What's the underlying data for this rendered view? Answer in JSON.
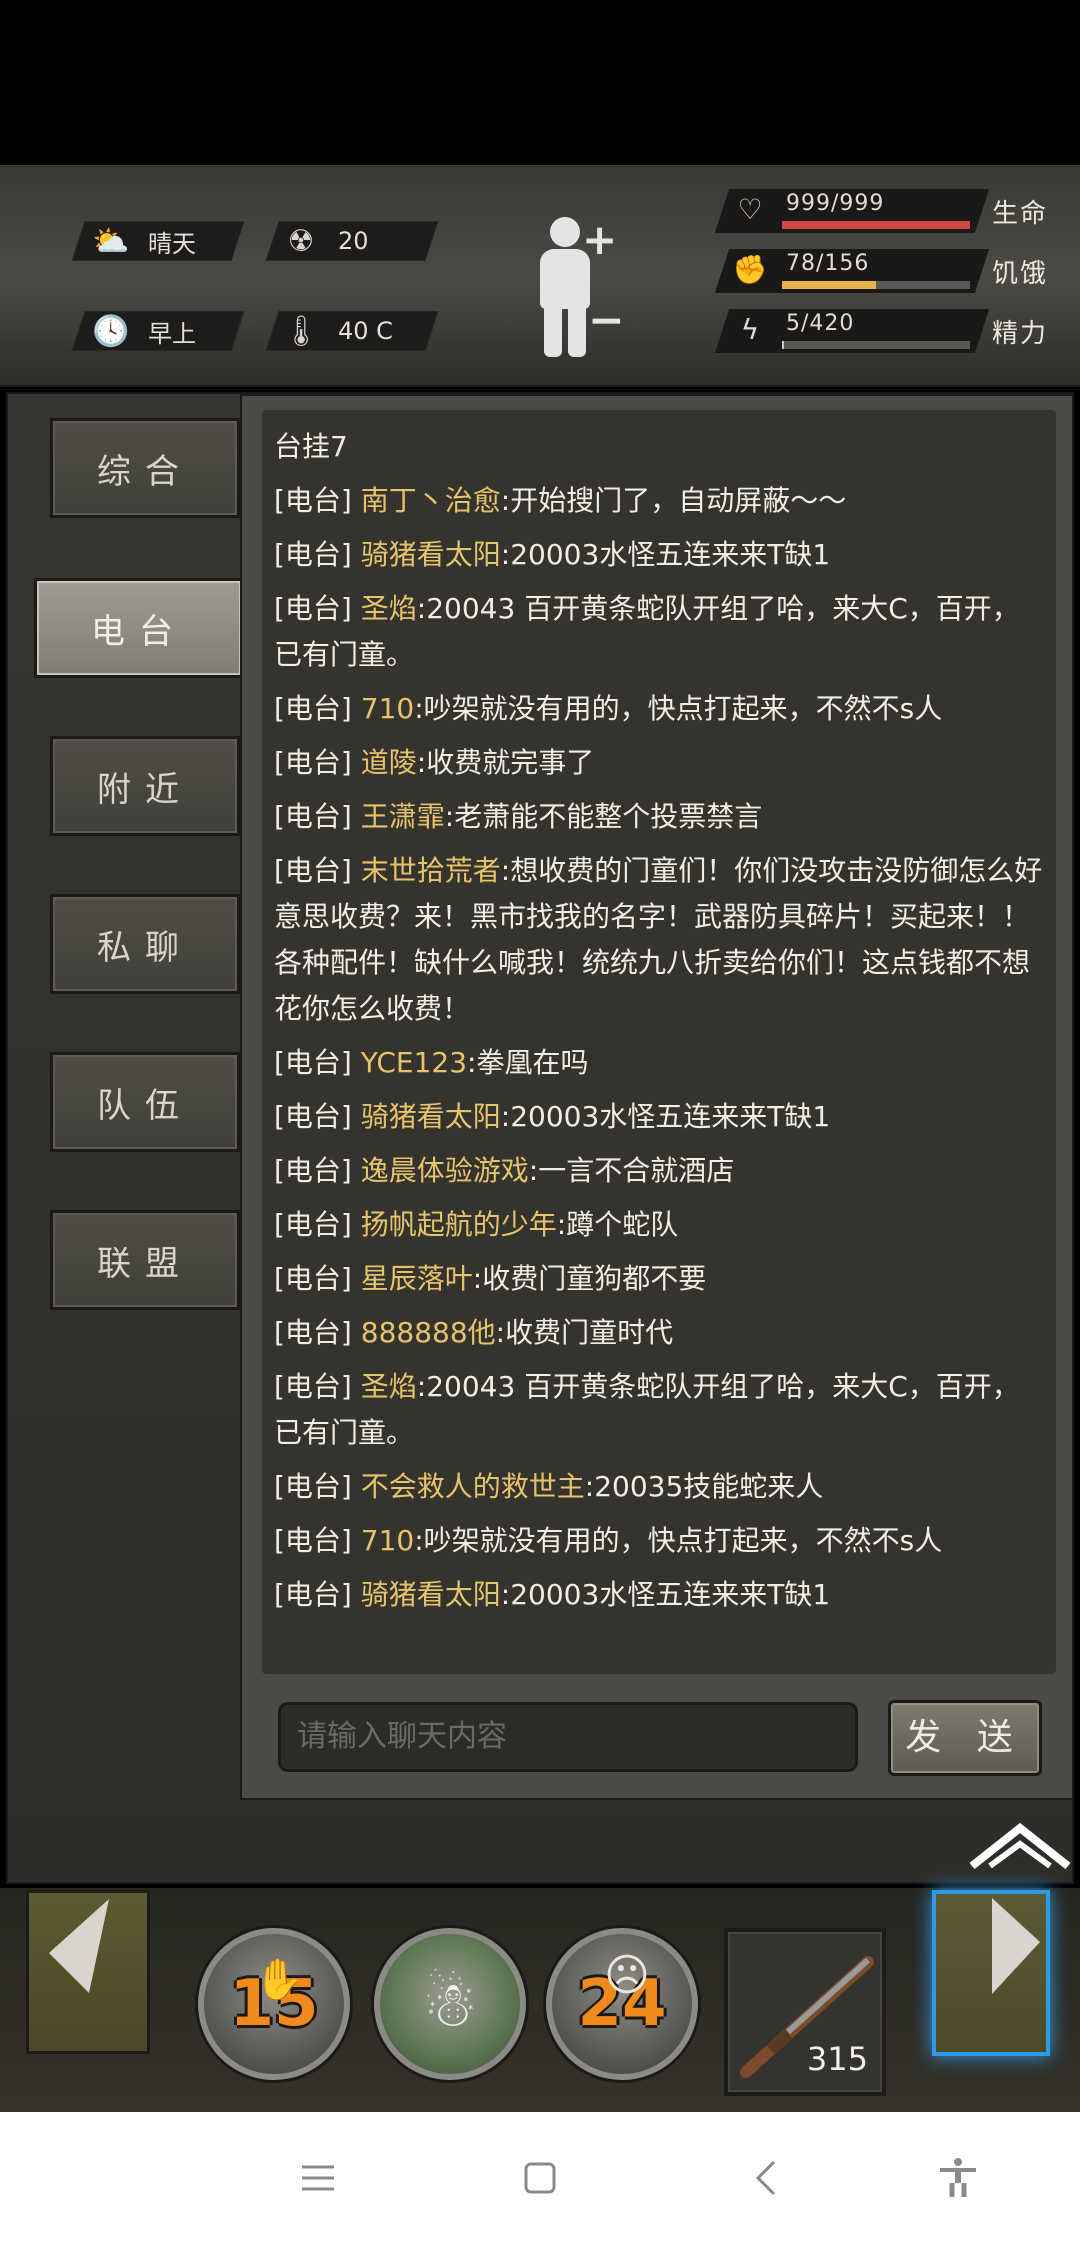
{
  "status": {
    "weather": "晴天",
    "radiation": "20",
    "time_of_day": "早上",
    "temperature": "40 C",
    "stats": [
      {
        "value": "999/999",
        "label": "生命",
        "fill": 1.0,
        "color": "#d0483f",
        "icon": "heart-icon"
      },
      {
        "value": "78/156",
        "label": "饥饿",
        "fill": 0.5,
        "color": "#e3b24a",
        "icon": "stomach-icon"
      },
      {
        "value": "5/420",
        "label": "精力",
        "fill": 0.012,
        "color": "#c9c7c0",
        "icon": "energy-icon"
      }
    ]
  },
  "tabs": [
    {
      "label": "综合",
      "active": false
    },
    {
      "label": "电台",
      "active": true
    },
    {
      "label": "附近",
      "active": false
    },
    {
      "label": "私聊",
      "active": false
    },
    {
      "label": "队伍",
      "active": false
    },
    {
      "label": "联盟",
      "active": false
    }
  ],
  "chat": {
    "first_line": "台挂7",
    "messages": [
      {
        "channel": "[电台]",
        "user": "南丁丶治愈",
        "text": ":开始搜门了，自动屏蔽～～"
      },
      {
        "channel": "[电台]",
        "user": "骑猪看太阳",
        "text": ":20003水怪五连来来T缺1"
      },
      {
        "channel": "[电台]",
        "user": "圣焰",
        "text": ":20043 百开黄条蛇队开组了哈，来大C，百开，已有门童。"
      },
      {
        "channel": "[电台]",
        "user": "710",
        "text": ":吵架就没有用的，快点打起来，不然不s人"
      },
      {
        "channel": "[电台]",
        "user": "道陵",
        "text": ":收费就完事了"
      },
      {
        "channel": "[电台]",
        "user": "王潇霏",
        "text": ":老萧能不能整个投票禁言"
      },
      {
        "channel": "[电台]",
        "user": "末世拾荒者",
        "text": ":想收费的门童们！你们没攻击没防御怎么好意思收费？来！黑市找我的名字！武器防具碎片！买起来！！各种配件！缺什么喊我！统统九八折卖给你们！这点钱都不想花你怎么收费！"
      },
      {
        "channel": "[电台]",
        "user": "YCE123",
        "text": ":拳凰在吗"
      },
      {
        "channel": "[电台]",
        "user": "骑猪看太阳",
        "text": ":20003水怪五连来来T缺1"
      },
      {
        "channel": "[电台]",
        "user": "逸晨体验游戏",
        "text": ":一言不合就酒店"
      },
      {
        "channel": "[电台]",
        "user": "扬帆起航的少年",
        "text": ":蹲个蛇队"
      },
      {
        "channel": "[电台]",
        "user": "星辰落叶",
        "text": ":收费门童狗都不要"
      },
      {
        "channel": "[电台]",
        "user": "888888他",
        "text": ":收费门童时代"
      },
      {
        "channel": "[电台]",
        "user": "圣焰",
        "text": ":20043 百开黄条蛇队开组了哈，来大C，百开，已有门童。"
      },
      {
        "channel": "[电台]",
        "user": "不会救人的救世主",
        "text": ":20035技能蛇来人"
      },
      {
        "channel": "[电台]",
        "user": "710",
        "text": ":吵架就没有用的，快点打起来，不然不s人"
      },
      {
        "channel": "[电台]",
        "user": "骑猪看太阳",
        "text": ":20003水怪五连来来T缺1"
      }
    ],
    "input_placeholder": "请输入聊天内容",
    "send_label": "发 送"
  },
  "action_bar": {
    "skills": [
      {
        "count": "15",
        "icon": "hand-bandage-icon"
      },
      {
        "count": "",
        "icon": "heal-figure-icon"
      },
      {
        "count": "24",
        "icon": "rage-face-icon"
      }
    ],
    "weapon_count": "315",
    "weapon_icon": "shotgun-icon"
  }
}
